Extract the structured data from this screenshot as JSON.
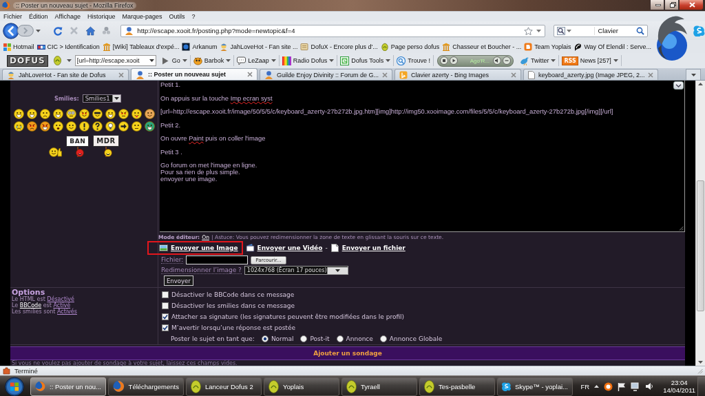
{
  "window": {
    "title": ":: Poster un nouveau sujet - Mozilla Firefox"
  },
  "menu": [
    "Fichier",
    "Édition",
    "Affichage",
    "Historique",
    "Marque-pages",
    "Outils",
    "?"
  ],
  "navigation": {
    "url": "http://escape.xooit.fr/posting.php?mode=newtopic&f=4",
    "search": "Clavier"
  },
  "bookmarks": [
    "Hotmail",
    "CIC > Identification",
    "[Wiki] Tableaux d'expé...",
    "Arkanum",
    "JahLoveHot - Fan site ...",
    "DofuX - Encore plus d'...",
    "Page perso dofus",
    "Chasseur et Boucher - ...",
    "Team Yoplais",
    "Way Of Elendil : Serve..."
  ],
  "toolbar": {
    "logo": "DOFUS",
    "field": "[url=http://escape.xooit",
    "items": [
      {
        "kind": "button",
        "label": "Go",
        "dropdown": true
      },
      {
        "kind": "button",
        "label": "Barbok",
        "dropdown": true
      },
      {
        "kind": "button",
        "label": "LeZaap",
        "dropdown": true
      },
      {
        "kind": "button",
        "label": "Radio Dofus",
        "dropdown": true
      },
      {
        "kind": "button",
        "label": "Dofus Tools",
        "dropdown": true
      },
      {
        "kind": "button",
        "label": "Trouve !",
        "dropdown": false
      },
      {
        "kind": "player",
        "track": "Ago'R..."
      },
      {
        "kind": "button",
        "label": "Twitter",
        "dropdown": true
      },
      {
        "kind": "button",
        "label": "News [257]",
        "badge": "RSS",
        "dropdown": true
      }
    ]
  },
  "tabs": [
    {
      "label": "JahLoveHot - Fan site de Dofus",
      "selected": false
    },
    {
      "label": ":: Poster un nouveau sujet",
      "selected": true
    },
    {
      "label": "Guilde Enjoy Divinity :: Forum de G...",
      "selected": false
    },
    {
      "label": "Clavier azerty - Bing Images",
      "selected": false
    },
    {
      "label": "keyboard_azerty.jpg (Image JPEG, 2...",
      "selected": false
    }
  ],
  "smilies": {
    "label": "Smilies:",
    "set": "Smilies1",
    "signs": [
      "BAN",
      "MDR"
    ]
  },
  "editor": {
    "paragraphs": [
      [
        [
          {
            "text": "Petit 1.",
            "misspelled": false
          }
        ]
      ],
      [
        [
          {
            "text": "On appuis sur la touche ",
            "misspelled": false
          },
          {
            "text": "Imp ecran syst",
            "misspelled": true
          }
        ]
      ],
      [
        [
          {
            "text": "[url=http://escape.xooit.fr/image/50/5/5/c/keyboard_azerty-27b272b.jpg.htm][img]http://img50.xooimage.com/files/5/5/c/keyboard_azerty-27b272b.jpg[/img][/url]",
            "misspelled": false
          }
        ]
      ],
      [
        [
          {
            "text": "Petit 2.",
            "misspelled": false
          }
        ]
      ],
      [
        [
          {
            "text": "On ouvre ",
            "misspelled": false
          },
          {
            "text": "Paint",
            "misspelled": true
          },
          {
            "text": " puis on coller l'image",
            "misspelled": false
          }
        ]
      ],
      [
        [
          {
            "text": "Petit 3 .",
            "misspelled": false
          }
        ]
      ],
      [
        [
          {
            "text": "Go forum on met l'image en ligne.",
            "misspelled": false
          }
        ],
        [
          {
            "text": "Pour sa rien de plus simple.",
            "misspelled": false
          }
        ],
        [
          {
            "text": "envoyer une image.",
            "misspelled": false
          }
        ]
      ]
    ],
    "mode_label": "Mode éditeur:",
    "mode_value": "On",
    "tip": "| Astuce: Vous pouvez redimensionner la zone de texte en glissant la souris sur ce texte."
  },
  "upload": {
    "links": [
      {
        "label": "Envoyer une Image",
        "highlighted": true
      },
      {
        "label": "Envoyer une Vidéo",
        "highlighted": false
      },
      {
        "separator": "-",
        "label": "Envoyer un fichier",
        "highlighted": false
      }
    ],
    "file_label": "Fichier:",
    "browse": "Parcourir...",
    "resize_label": "Redimensionner l’image ?",
    "resize_value": "1024x768 (Écran 17 pouces)",
    "submit": "Envoyer"
  },
  "options": {
    "title": "Options",
    "rules": [
      [
        {
          "kind": "text",
          "text": "Le HTML est "
        },
        {
          "kind": "link",
          "text": "Désactivé"
        }
      ],
      [
        {
          "kind": "text",
          "text": "Le "
        },
        {
          "kind": "help",
          "text": "BBCode"
        },
        {
          "kind": "text",
          "text": " est "
        },
        {
          "kind": "link",
          "text": "Activé"
        }
      ],
      [
        {
          "kind": "text",
          "text": "Les smilies sont "
        },
        {
          "kind": "link",
          "text": "Activés"
        }
      ]
    ],
    "checkboxes": [
      {
        "label": "Désactiver le BBCode dans ce message",
        "checked": false
      },
      {
        "label": "Désactiver les smilies dans ce message",
        "checked": false
      },
      {
        "label": "Attacher sa signature (les signatures peuvent être modifiées dans le profil)",
        "checked": true
      },
      {
        "label": "M’avertir lorsqu’une réponse est postée",
        "checked": true
      }
    ],
    "post_type": {
      "label": "Poster le sujet en tant que:",
      "options": [
        {
          "label": "Normal",
          "selected": true
        },
        {
          "label": "Post-it",
          "selected": false
        },
        {
          "label": "Annonce",
          "selected": false
        },
        {
          "label": "Annonce Globale",
          "selected": false
        }
      ]
    }
  },
  "poll": {
    "title": "Ajouter un sondage",
    "hint": "Si vous ne voulez pas ajouter de sondage à votre sujet, laissez ces champs vides."
  },
  "status_bar": "Terminé",
  "taskbar": {
    "items": [
      {
        "kind": "browser",
        "label": ":: Poster un nou...",
        "selected": true
      },
      {
        "kind": "browser",
        "label": "Téléchargements",
        "selected": false
      },
      {
        "kind": "game",
        "label": "Lanceur Dofus 2",
        "selected": false
      },
      {
        "kind": "game",
        "label": "Yoplais",
        "selected": false
      },
      {
        "kind": "game",
        "label": "Tyraell",
        "selected": false
      },
      {
        "kind": "game",
        "label": "Tes-pasbelle",
        "selected": false
      },
      {
        "kind": "messenger",
        "label": "Skype™ - yoplai...",
        "selected": false
      }
    ],
    "language": "FR",
    "time": "23:04",
    "date": "14/04/2011"
  }
}
